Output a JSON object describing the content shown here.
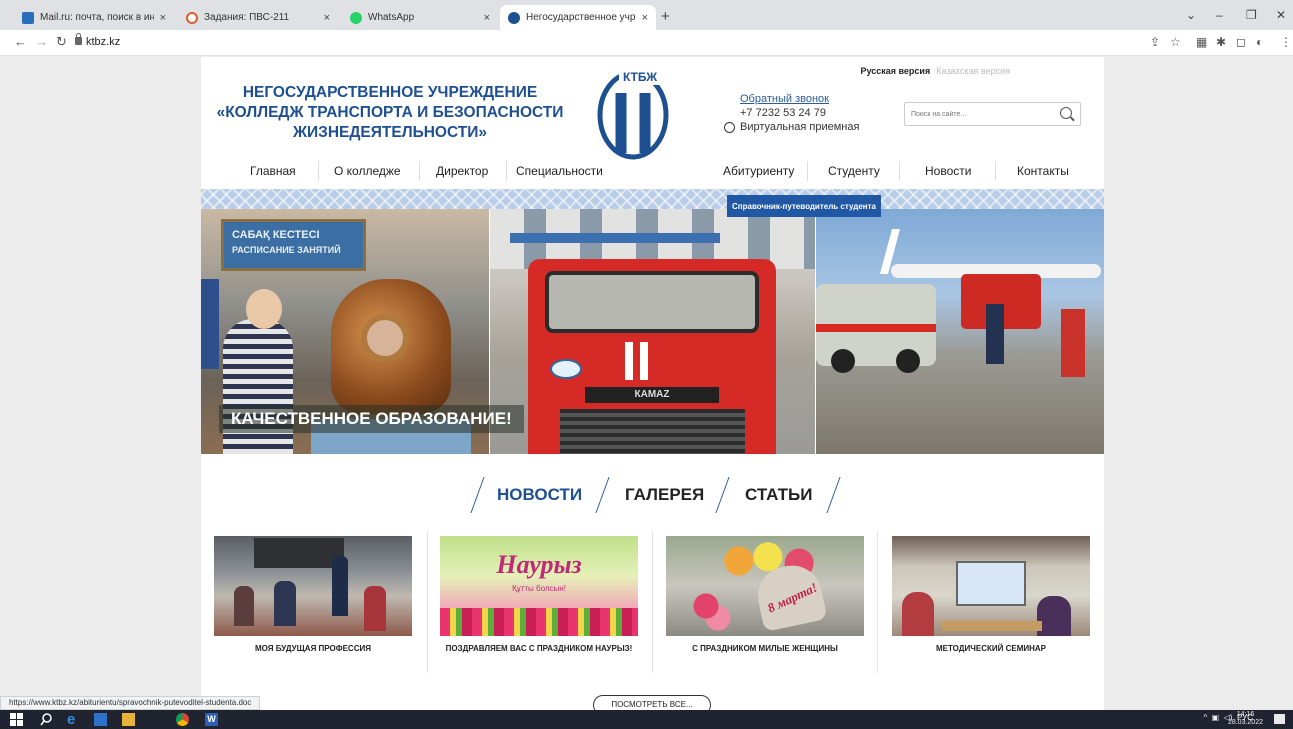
{
  "browser": {
    "tabs": [
      {
        "title": "Mail.ru: почта, поиск в интернет",
        "close": "×",
        "fav": "#2a6ebb"
      },
      {
        "title": "Задания: ПВС-211",
        "close": "×",
        "fav": "#e05a2b"
      },
      {
        "title": "WhatsApp",
        "close": "×",
        "fav": "#25d366"
      },
      {
        "title": "Негосударственное учрежден",
        "close": "×",
        "fav": "#1d4f91"
      }
    ],
    "new_tab": "+",
    "url": "ktbz.kz",
    "status_url": "https://www.ktbz.kz/abiturientu/spravochnik-putevoditel-studenta.doc"
  },
  "site": {
    "lang_ru": "Русская версия",
    "lang_kz": "Казахская версия",
    "title_line1": "НЕГОСУДАРСТВЕННОЕ УЧРЕЖДЕНИЕ",
    "title_line2": "«КОЛЛЕДЖ ТРАНСПОРТА И БЕЗОПАСНОСТИ",
    "title_line3": "ЖИЗНЕДЕЯТЕЛЬНОСТИ»",
    "logo_text": "КТБЖ",
    "callback": "Обратный звонок",
    "phone": "+7 7232 53 24 79",
    "reception": "Виртуальная приемная",
    "search_placeholder": "Поиск на сайте...",
    "menu": [
      "Главная",
      "О колледже",
      "Директор",
      "Специальности",
      "Абитуриенту",
      "Студенту",
      "Новости",
      "Контакты"
    ],
    "dropdown_item": "Справочник-путеводитель студента",
    "banner_caption": "КАЧЕСТВЕННОЕ ОБРАЗОВАНИЕ!",
    "banner_sign1": "САБАҚ КЕСТЕСІ",
    "banner_sign2": "РАСПИСАНИЕ ЗАНЯТИЙ",
    "truck_brand": "КАМАZ",
    "section_tabs": [
      "НОВОСТИ",
      "ГАЛЕРЕЯ",
      "СТАТЬИ"
    ],
    "news": [
      {
        "title": "МОЯ БУДУЩАЯ ПРОФЕССИЯ"
      },
      {
        "title": "ПОЗДРАВЛЯЕМ ВАС С ПРАЗДНИКОМ НАУРЫЗ!",
        "img_text": "Наурыз",
        "img_sub": "Құтты болсын!"
      },
      {
        "title": "С ПРАЗДНИКОМ МИЛЫЕ ЖЕНЩИНЫ",
        "img_text": "8 марта!"
      },
      {
        "title": "МЕТОДИЧЕСКИЙ СЕМИНАР"
      }
    ],
    "more_button": "ПОСМОТРЕТЬ ВСЕ..."
  },
  "taskbar": {
    "tray_lang": "РУС",
    "time": "14:16",
    "date": "28.03.2022"
  },
  "colors": {
    "brand": "#1d4f91",
    "dropdown": "#2158a6"
  }
}
